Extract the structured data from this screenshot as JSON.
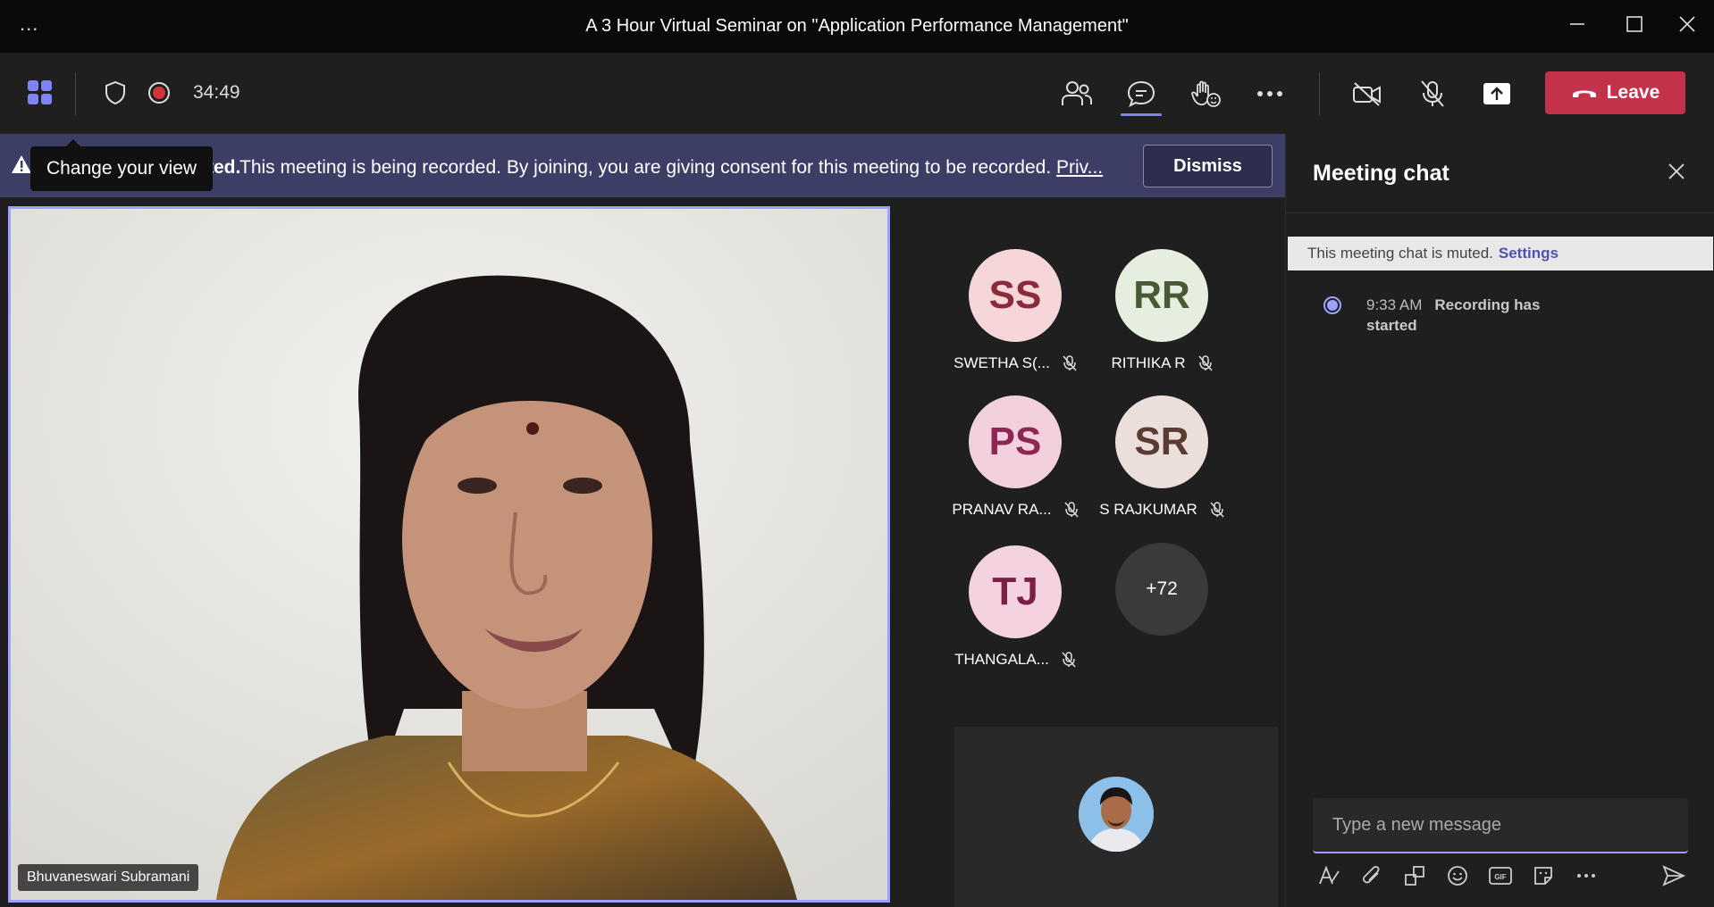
{
  "window": {
    "title": "A 3 Hour Virtual Seminar on \"Application Performance Management\"",
    "menu_label": "..."
  },
  "toolbar": {
    "timer": "34:49",
    "leave_label": "Leave"
  },
  "banner": {
    "bold_tail": "ted.",
    "message": "This meeting is being recorded. By joining, you are giving consent for this meeting to be recorded.",
    "privacy_link": "Priv...",
    "dismiss_label": "Dismiss"
  },
  "tooltip": {
    "text": "Change your view"
  },
  "speaker": {
    "name": "Bhuvaneswari Subramani"
  },
  "participants": [
    {
      "initials": "SS",
      "name": "SWETHA S(...",
      "bg": "#f6d6d9",
      "fg": "#8b2b3a"
    },
    {
      "initials": "RR",
      "name": "RITHIKA R",
      "bg": "#e6efdf",
      "fg": "#4a5a35"
    },
    {
      "initials": "PS",
      "name": "PRANAV RA...",
      "bg": "#f3d0dd",
      "fg": "#8c2754"
    },
    {
      "initials": "SR",
      "name": "S RAJKUMAR",
      "bg": "#ecdedb",
      "fg": "#5a3c33"
    },
    {
      "initials": "TJ",
      "name": "THANGALA...",
      "bg": "#f5d2e0",
      "fg": "#7a2048"
    }
  ],
  "more_participants": "+72",
  "chat": {
    "title": "Meeting chat",
    "muted_text": "This meeting chat is muted.",
    "settings_link": "Settings",
    "event_time": "9:33 AM",
    "event_text": "Recording has started",
    "composer_placeholder": "Type a new message"
  }
}
